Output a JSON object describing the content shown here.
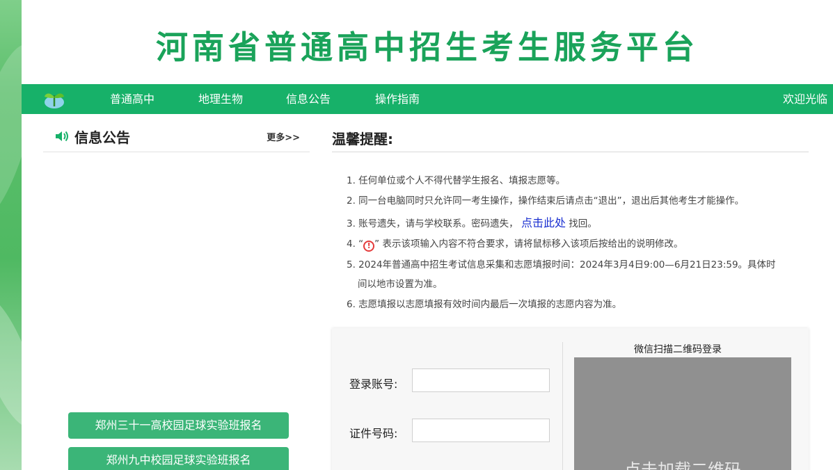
{
  "header": {
    "title": "河南省普通高中招生考生服务平台"
  },
  "nav": {
    "items": [
      {
        "label": "普通高中"
      },
      {
        "label": "地理生物"
      },
      {
        "label": "信息公告"
      },
      {
        "label": "操作指南"
      }
    ],
    "welcome": "欢迎光临"
  },
  "news": {
    "title": "信息公告",
    "more": "更多>>",
    "buttons": [
      {
        "label": "郑州三十一高校园足球实验班报名"
      },
      {
        "label": "郑州九中校园足球实验班报名"
      }
    ]
  },
  "tips": {
    "title": "温馨提醒:",
    "items": [
      "1. 任何单位或个人不得代替学生报名、填报志愿等。",
      "2. 同一台电脑同时只允许同一考生操作，操作结束后请点击“退出”，退出后其他考生才能操作。",
      {
        "before": "3. 账号遗失，请与学校联系。密码遗失，",
        "link": "点击此处",
        "after": "找回。"
      },
      {
        "before": "4. “",
        "icon": "!",
        "after": "” 表示该项输入内容不符合要求，请将鼠标移入该项后按给出的说明修改。"
      },
      "5. 2024年普通高中招生考试信息采集和志愿填报时间：2024年3月4日9:00—6月21日23:59。具体时",
      "间以地市设置为准。",
      "6. 志愿填报以志愿填报有效时间内最后一次填报的志愿内容为准。"
    ]
  },
  "login": {
    "account_label": "登录账号:",
    "account_value": "",
    "id_label": "证件号码:",
    "id_value": "",
    "qr_title": "微信扫描二维码登录",
    "qr_text": "点击加载二维码"
  },
  "colors": {
    "brand": "#17b169",
    "title": "#1aa35a",
    "button": "#3bb578",
    "link": "#1a2fd0",
    "warn": "#e43a3a"
  },
  "icons": {
    "logo": "sprout-logo-icon",
    "speaker": "speaker-icon",
    "warn": "exclamation-circle-icon"
  }
}
